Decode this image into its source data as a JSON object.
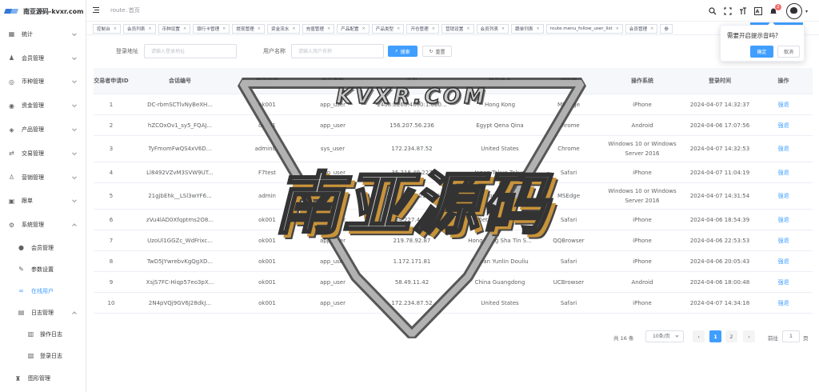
{
  "app": {
    "logo_text": "南亚源码-kvxr.com"
  },
  "breadcrumb": {
    "part1": "route",
    "part2": "首页"
  },
  "header": {
    "notification_count": "2"
  },
  "sidebar": {
    "items": [
      {
        "label": "统计",
        "icon": "dashboard-icon"
      },
      {
        "label": "会员管理",
        "icon": "users-icon"
      },
      {
        "label": "币种管理",
        "icon": "coin-icon"
      },
      {
        "label": "资金管理",
        "icon": "wallet-icon"
      },
      {
        "label": "产品管理",
        "icon": "product-icon"
      },
      {
        "label": "交易管理",
        "icon": "trade-icon"
      },
      {
        "label": "营销管理",
        "icon": "marketing-icon"
      },
      {
        "label": "跟单",
        "icon": "follow-icon"
      },
      {
        "label": "系统管理",
        "icon": "gear-icon"
      }
    ],
    "system_sub": [
      {
        "label": "会员管理",
        "icon": "user-icon"
      },
      {
        "label": "参数设置",
        "icon": "edit-icon"
      },
      {
        "label": "在线用户",
        "icon": "link-icon"
      },
      {
        "label": "日志管理",
        "icon": "log-icon"
      }
    ],
    "log_sub": [
      {
        "label": "操作日志",
        "icon": "operation-log-icon"
      },
      {
        "label": "登录日志",
        "icon": "login-log-icon"
      }
    ],
    "bottom": {
      "label": "图形管理",
      "icon": "shirt-icon"
    }
  },
  "tags": [
    "控制台",
    "会员列表",
    "币种设置",
    "银行卡管理",
    "提现管理",
    "资金流水",
    "充值管理",
    "产品配置",
    "产品类型",
    "开仓管理",
    "营销设置",
    "会员列表",
    "跟单列表",
    "route.menu_follow_user_list",
    "会员管理",
    "参"
  ],
  "search": {
    "login_addr_label": "登录地址",
    "login_addr_placeholder": "请输入登录地址",
    "username_label": "用户名称",
    "username_placeholder": "请输入用户名称",
    "search_button": "搜索",
    "reset_button": "重置"
  },
  "table": {
    "headers": [
      "交易者申请ID",
      "会话编号",
      "登录名称",
      "用户类型",
      "主机",
      "登录地点",
      "浏览器",
      "操作系统",
      "登录时间",
      "操作"
    ],
    "rows": [
      [
        "1",
        "DC-rbmSCTlvNyBeXH...",
        "ok001",
        "app_user",
        "2408:8266:4800:1:0b0...",
        "Hong Kong",
        "MSEdge",
        "iPhone",
        "2024-04-07 14:32:37",
        "强退"
      ],
      [
        "2",
        "hZCOxOv1_sy5_FQAJ...",
        "ok001",
        "app_user",
        "156.207.56.236",
        "Egypt Qena Qina",
        "Chrome",
        "Android",
        "2024-04-06 17:07:56",
        "强退"
      ],
      [
        "3",
        "TyFmomFwQS4xV6D...",
        "admin01",
        "sys_user",
        "172.234.87.52",
        "United States",
        "Chrome",
        "Windows 10 or Windows Server 2016",
        "2024-04-07 14:32:53",
        "强退"
      ],
      [
        "4",
        "Ll8492VZvM3SVW9UT...",
        "F7test",
        "app_user",
        "35.218.49.227",
        "Japan Tokyo Tokyo",
        "Safari",
        "iPhone",
        "2024-04-07 11:04:19",
        "强退"
      ],
      [
        "5",
        "21gjbEhk__LSl3wYF6...",
        "admin",
        "sys_user",
        "2407:cdc0:9001::1065",
        "Hong Kong",
        "MSEdge",
        "Windows 10 or Windows Server 2016",
        "2024-04-07 14:31:54",
        "强退"
      ],
      [
        "6",
        "zVu4lAD0Xfqptms2O8...",
        "ok001",
        "app_user",
        "154.227.4.181",
        "Viet Nam Ha Noi",
        "Safari",
        "iPhone",
        "2024-04-06 18:54:39",
        "强退"
      ],
      [
        "7",
        "UzoUl1GGZc_WdFrixc...",
        "ok001",
        "app_user",
        "219.78.92.87",
        "Hong Kong Sha Tin S...",
        "QQBrowser",
        "iPhone",
        "2024-04-06 22:53:53",
        "强退"
      ],
      [
        "8",
        "TwD5JYwrebvKgQgXD...",
        "ok001",
        "app_user",
        "1.172.171.81",
        "Taiwan Yunlin Douliu",
        "Safari",
        "iPhone",
        "2024-04-06 20:05:43",
        "强退"
      ],
      [
        "9",
        "XsjS7FC-Hiqp57eo3pX...",
        "ok001",
        "app_user",
        "58.49.11.42",
        "China Guangdong",
        "UCBrowser",
        "Android",
        "2024-04-06 18:00:48",
        "强退"
      ],
      [
        "10",
        "2N4pVQj9GV6J28dkJ...",
        "ok001",
        "app_user",
        "172.234.87.52",
        "United States",
        "Safari",
        "iPhone",
        "2024-04-07 14:34:18",
        "强退"
      ]
    ]
  },
  "pagination": {
    "total": "共 16 条",
    "page_size": "10条/页",
    "pages": [
      "1",
      "2"
    ],
    "current_page": "1",
    "prev": "‹",
    "next": "›",
    "goto_label": "前往",
    "goto_value": "1",
    "page_suffix": "页"
  },
  "popconfirm": {
    "message": "需要开启提示音吗?",
    "confirm": "确定",
    "cancel": "取消"
  },
  "watermark": {
    "url": "KVXR.COM",
    "name": "南亚源码"
  },
  "colors": {
    "primary": "#409eff",
    "danger": "#f56c6c"
  }
}
